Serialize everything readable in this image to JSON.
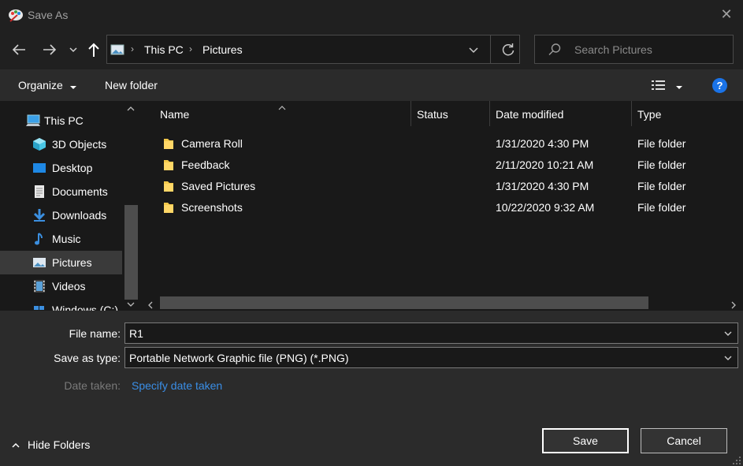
{
  "window": {
    "title": "Save As"
  },
  "address": {
    "crumbs": [
      "This PC",
      "Pictures"
    ]
  },
  "search": {
    "placeholder": "Search Pictures"
  },
  "toolbar": {
    "organize_label": "Organize",
    "new_folder_label": "New folder"
  },
  "sidebar": {
    "items": [
      {
        "label": "This PC",
        "icon": "computer-icon"
      },
      {
        "label": "3D Objects",
        "icon": "cube-icon"
      },
      {
        "label": "Desktop",
        "icon": "desktop-icon"
      },
      {
        "label": "Documents",
        "icon": "document-icon"
      },
      {
        "label": "Downloads",
        "icon": "download-icon"
      },
      {
        "label": "Music",
        "icon": "music-icon"
      },
      {
        "label": "Pictures",
        "icon": "pictures-icon",
        "selected": true
      },
      {
        "label": "Videos",
        "icon": "video-icon"
      },
      {
        "label": "Windows (C:)",
        "icon": "drive-icon"
      }
    ]
  },
  "file_list": {
    "columns": [
      "Name",
      "Status",
      "Date modified",
      "Type"
    ],
    "rows": [
      {
        "name": "Camera Roll",
        "date": "1/31/2020 4:30 PM",
        "type": "File folder"
      },
      {
        "name": "Feedback",
        "date": "2/11/2020 10:21 AM",
        "type": "File folder"
      },
      {
        "name": "Saved Pictures",
        "date": "1/31/2020 4:30 PM",
        "type": "File folder"
      },
      {
        "name": "Screenshots",
        "date": "10/22/2020 9:32 AM",
        "type": "File folder"
      }
    ]
  },
  "form": {
    "file_name_label": "File name:",
    "file_name_value": "R1",
    "save_type_label": "Save as type:",
    "save_type_value": "Portable Network Graphic file (PNG) (*.PNG)",
    "date_taken_label": "Date taken:",
    "date_taken_link": "Specify date taken"
  },
  "footer": {
    "hide_folders_label": "Hide Folders",
    "save_label": "Save",
    "cancel_label": "Cancel"
  },
  "colors": {
    "accent": "#0078d7",
    "link": "#3a8ee6",
    "help": "#1a73e8"
  }
}
